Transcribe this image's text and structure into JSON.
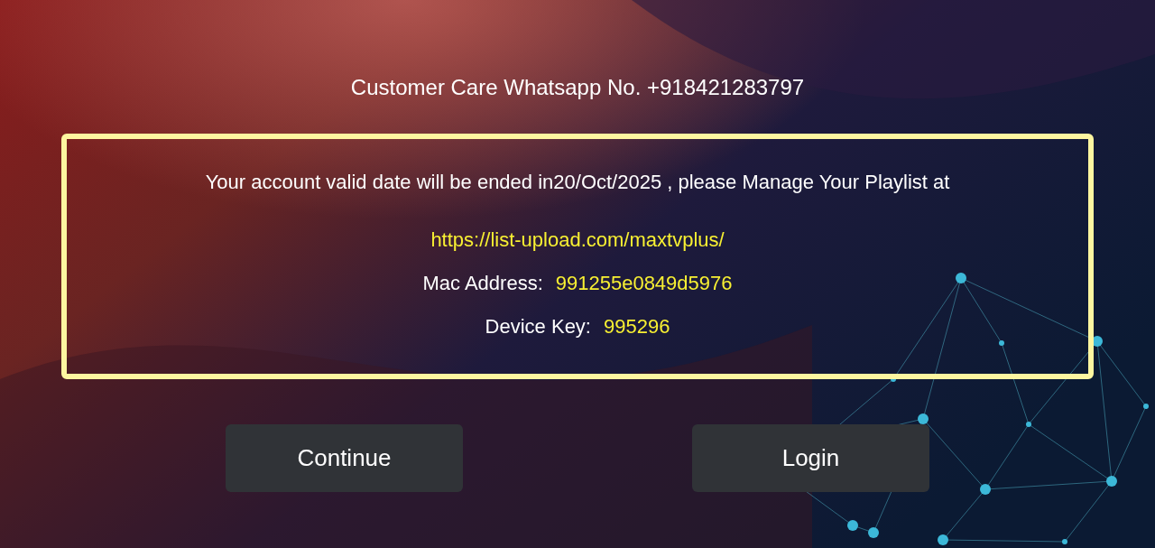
{
  "customer_care": "Customer Care Whatsapp No. +918421283797",
  "notice": {
    "message": "Your account valid date will be ended in20/Oct/2025 , please Manage Your Playlist at",
    "link": "https://list-upload.com/maxtvplus/",
    "fields": [
      {
        "label": "Mac Address:",
        "value": "991255e0849d5976"
      },
      {
        "label": "Device Key:",
        "value": "995296"
      }
    ]
  },
  "buttons": [
    "Continue",
    "Login"
  ]
}
